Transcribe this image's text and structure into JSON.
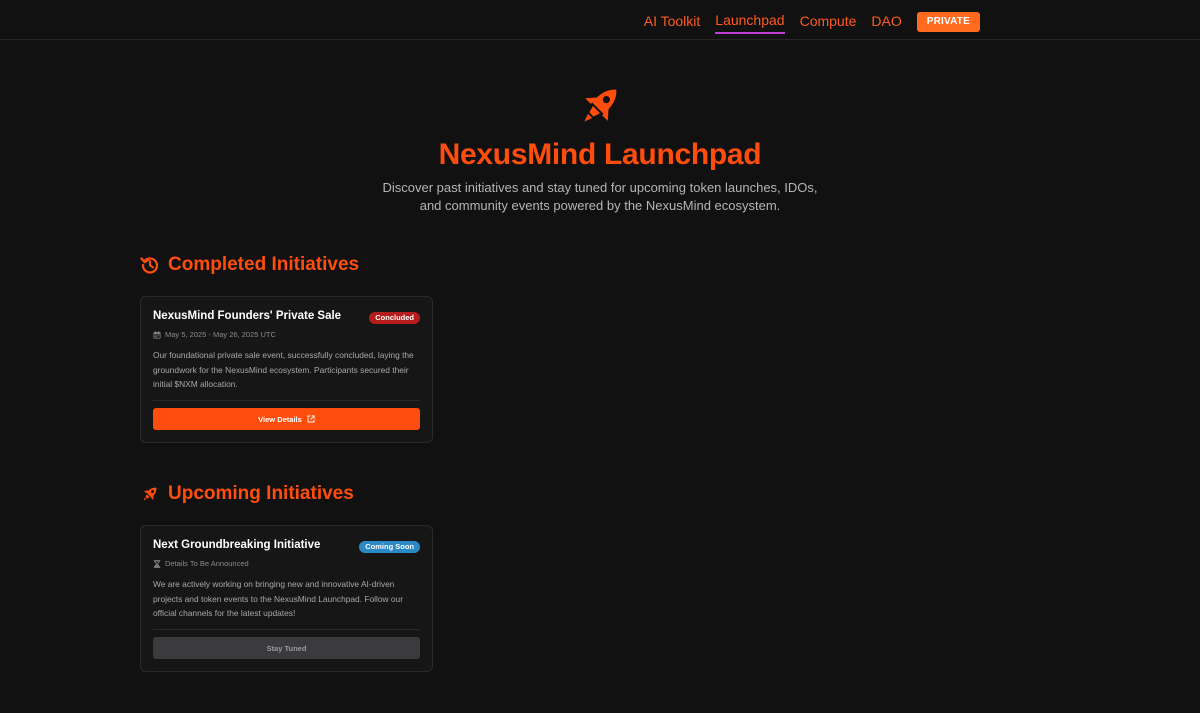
{
  "nav": {
    "items": [
      {
        "label": "AI Toolkit",
        "active": false
      },
      {
        "label": "Launchpad",
        "active": true
      },
      {
        "label": "Compute",
        "active": false
      },
      {
        "label": "DAO",
        "active": false
      }
    ],
    "private_label": "PRIVATE"
  },
  "hero": {
    "icon": "rocket-icon",
    "title": "NexusMind Launchpad",
    "subtitle": "Discover past initiatives and stay tuned for upcoming token launches, IDOs, and community events powered by the NexusMind ecosystem."
  },
  "sections": {
    "completed": {
      "icon": "history-icon",
      "title": "Completed Initiatives",
      "card": {
        "title": "NexusMind Founders' Private Sale",
        "badge": "Concluded",
        "meta_icon": "calendar-icon",
        "meta": "May 5, 2025 - May 26, 2025 UTC",
        "description": "Our foundational private sale event, successfully concluded, laying the groundwork for the NexusMind ecosystem. Participants secured their initial $NXM allocation.",
        "button": "View Details",
        "button_icon": "external-link-icon"
      }
    },
    "upcoming": {
      "icon": "rocket-icon",
      "title": "Upcoming Initiatives",
      "card": {
        "title": "Next Groundbreaking Initiative",
        "badge": "Coming Soon",
        "meta_icon": "hourglass-icon",
        "meta": "Details To Be Announced",
        "description": "We are actively working on bringing new and innovative AI-driven projects and token events to the NexusMind Launchpad. Follow our official channels for the latest updates!",
        "button": "Stay Tuned"
      }
    }
  },
  "colors": {
    "background": "#111111",
    "accent": "#ff4d0d",
    "nav_link": "#ff5a1f",
    "active_underline": "#c13cd6",
    "concluded_badge": "#b71c1c",
    "coming_soon_badge": "#2b8ac6"
  }
}
